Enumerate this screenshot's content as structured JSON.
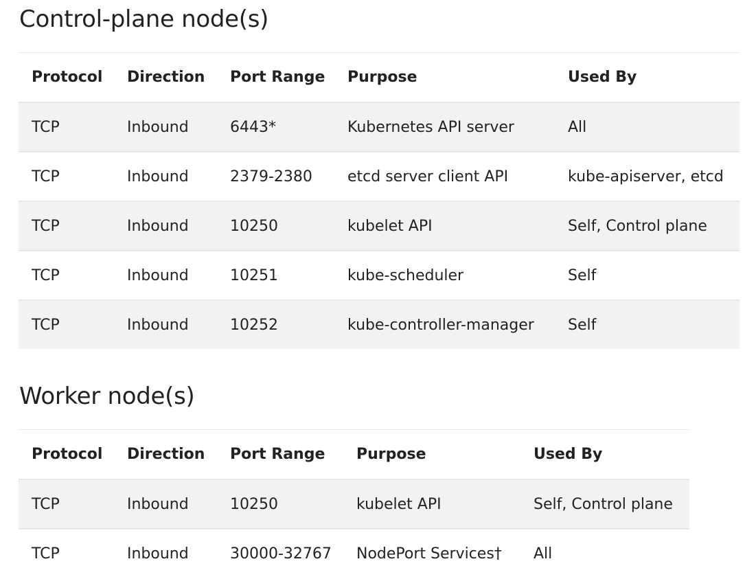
{
  "control_plane": {
    "title": "Control-plane node(s)",
    "columns": [
      "Protocol",
      "Direction",
      "Port Range",
      "Purpose",
      "Used By"
    ],
    "rows": [
      [
        "TCP",
        "Inbound",
        "6443*",
        "Kubernetes API server",
        "All"
      ],
      [
        "TCP",
        "Inbound",
        "2379-2380",
        "etcd server client API",
        "kube-apiserver, etcd"
      ],
      [
        "TCP",
        "Inbound",
        "10250",
        "kubelet API",
        "Self, Control plane"
      ],
      [
        "TCP",
        "Inbound",
        "10251",
        "kube-scheduler",
        "Self"
      ],
      [
        "TCP",
        "Inbound",
        "10252",
        "kube-controller-manager",
        "Self"
      ]
    ]
  },
  "worker": {
    "title": "Worker node(s)",
    "columns": [
      "Protocol",
      "Direction",
      "Port Range",
      "Purpose",
      "Used By"
    ],
    "rows": [
      [
        "TCP",
        "Inbound",
        "10250",
        "kubelet API",
        "Self, Control plane"
      ],
      [
        "TCP",
        "Inbound",
        "30000-32767",
        "NodePort Services†",
        "All"
      ]
    ]
  }
}
